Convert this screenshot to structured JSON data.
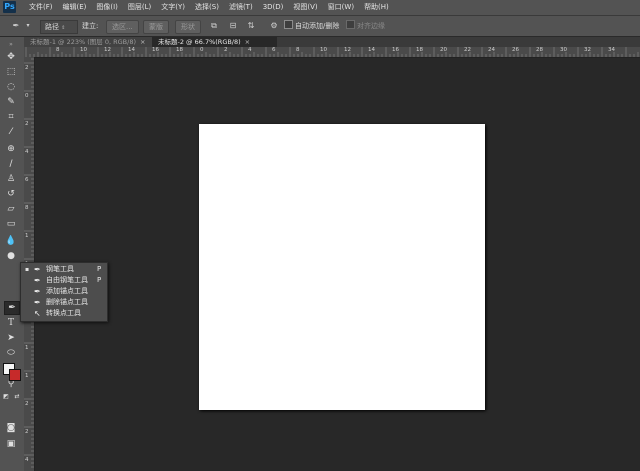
{
  "app": {
    "logo": "Ps"
  },
  "menu": [
    "文件(F)",
    "编辑(E)",
    "图像(I)",
    "图层(L)",
    "文字(Y)",
    "选择(S)",
    "滤镜(T)",
    "3D(D)",
    "视图(V)",
    "窗口(W)",
    "帮助(H)"
  ],
  "options": {
    "mode_select": "路径",
    "make_label": "建立:",
    "selection_btn": "选区...",
    "mask_btn": "蒙版",
    "shape_btn": "形状",
    "auto_add_delete": "自动添加/删除",
    "align_edges": "对齐边缘"
  },
  "tabs": [
    {
      "label": "未标题-1 @ 223% (图层 0, RGB/8)",
      "close": "×",
      "active": false
    },
    {
      "label": "未标题-2 @ 66.7%(RGB/8)",
      "close": "×",
      "active": true
    }
  ],
  "ruler": {
    "h_labels": [
      "8",
      "10",
      "12",
      "14",
      "16",
      "18",
      "0",
      "2",
      "4",
      "6",
      "8",
      "10",
      "12",
      "14",
      "16",
      "18",
      "20",
      "22",
      "24",
      "26",
      "28",
      "30",
      "32",
      "34"
    ],
    "v_labels": [
      "2",
      "0",
      "2",
      "4",
      "6",
      "8",
      "1",
      "1",
      "1",
      "1",
      "1",
      "1",
      "2",
      "2",
      "4"
    ]
  },
  "flyout": {
    "items": [
      {
        "bullet": "▪",
        "icon": "pen-icon",
        "glyph": "✒",
        "label": "钢笔工具",
        "key": "P"
      },
      {
        "bullet": "",
        "icon": "freeform-pen-icon",
        "glyph": "✒",
        "label": "自由钢笔工具",
        "key": "P"
      },
      {
        "bullet": "",
        "icon": "add-anchor-icon",
        "glyph": "✒",
        "label": "添加锚点工具",
        "key": ""
      },
      {
        "bullet": "",
        "icon": "delete-anchor-icon",
        "glyph": "✒",
        "label": "删除锚点工具",
        "key": ""
      },
      {
        "bullet": "",
        "icon": "convert-point-icon",
        "glyph": "↖",
        "label": "转换点工具",
        "key": ""
      }
    ]
  },
  "colors": {
    "foreground": "#f4f4f4",
    "background": "#c62a2a",
    "canvas": "#ffffff"
  }
}
